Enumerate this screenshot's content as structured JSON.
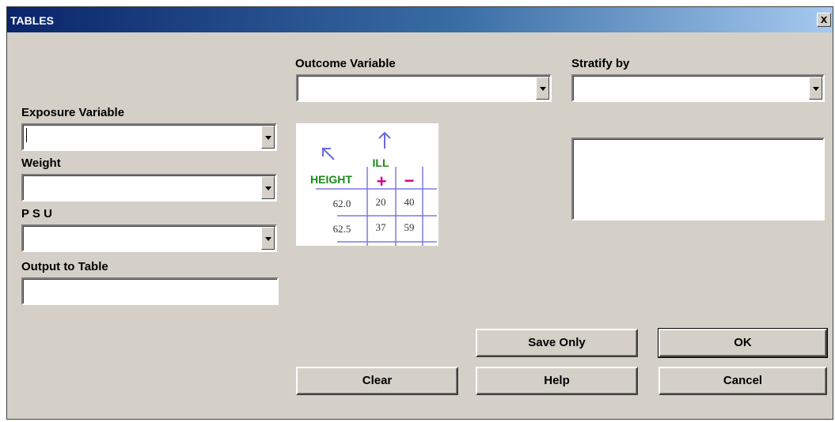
{
  "window": {
    "title": "TABLES",
    "close_label": "x"
  },
  "labels": {
    "outcome": "Outcome Variable",
    "stratify": "Stratify by",
    "exposure": "Exposure Variable",
    "weight": "Weight",
    "psu": "P S U",
    "output": "Output to Table"
  },
  "fields": {
    "outcome_value": "",
    "stratify_value": "",
    "exposure_value": "",
    "weight_value": "",
    "psu_value": "",
    "output_value": ""
  },
  "buttons": {
    "save_only": "Save Only",
    "ok": "OK",
    "clear": "Clear",
    "help": "Help",
    "cancel": "Cancel"
  },
  "illustration": {
    "column_variable": "ILL",
    "row_variable": "HEIGHT",
    "column_headers": [
      "+",
      "−"
    ],
    "rows": [
      {
        "label": "62.0",
        "values": [
          "20",
          "40"
        ]
      },
      {
        "label": "62.5",
        "values": [
          "37",
          "59"
        ]
      }
    ]
  },
  "colors": {
    "title_gradient_start": "#0a246a",
    "illustration_green": "#1a8a1a",
    "illustration_magenta": "#d2008c",
    "illustration_blue": "#6a6ae0"
  }
}
